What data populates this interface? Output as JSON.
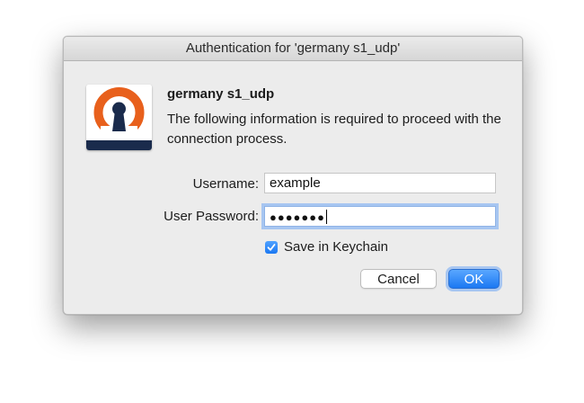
{
  "dialog": {
    "title": "Authentication for 'germany s1_udp'",
    "app_icon": "openvpn-logo-icon",
    "connection_name": "germany s1_udp",
    "message": "The following information is required to proceed with the connection process.",
    "username_label": "Username:",
    "username_value": "example",
    "password_label": "User Password:",
    "password_masked": "●●●●●●●",
    "save_keychain_label": "Save in Keychain",
    "save_keychain_checked": true,
    "cancel_label": "Cancel",
    "ok_label": "OK"
  },
  "colors": {
    "accent": "#1b78f2",
    "focus_ring": "#a7c6f1",
    "logo_orange": "#e8601c",
    "logo_navy": "#1a2b4c"
  }
}
